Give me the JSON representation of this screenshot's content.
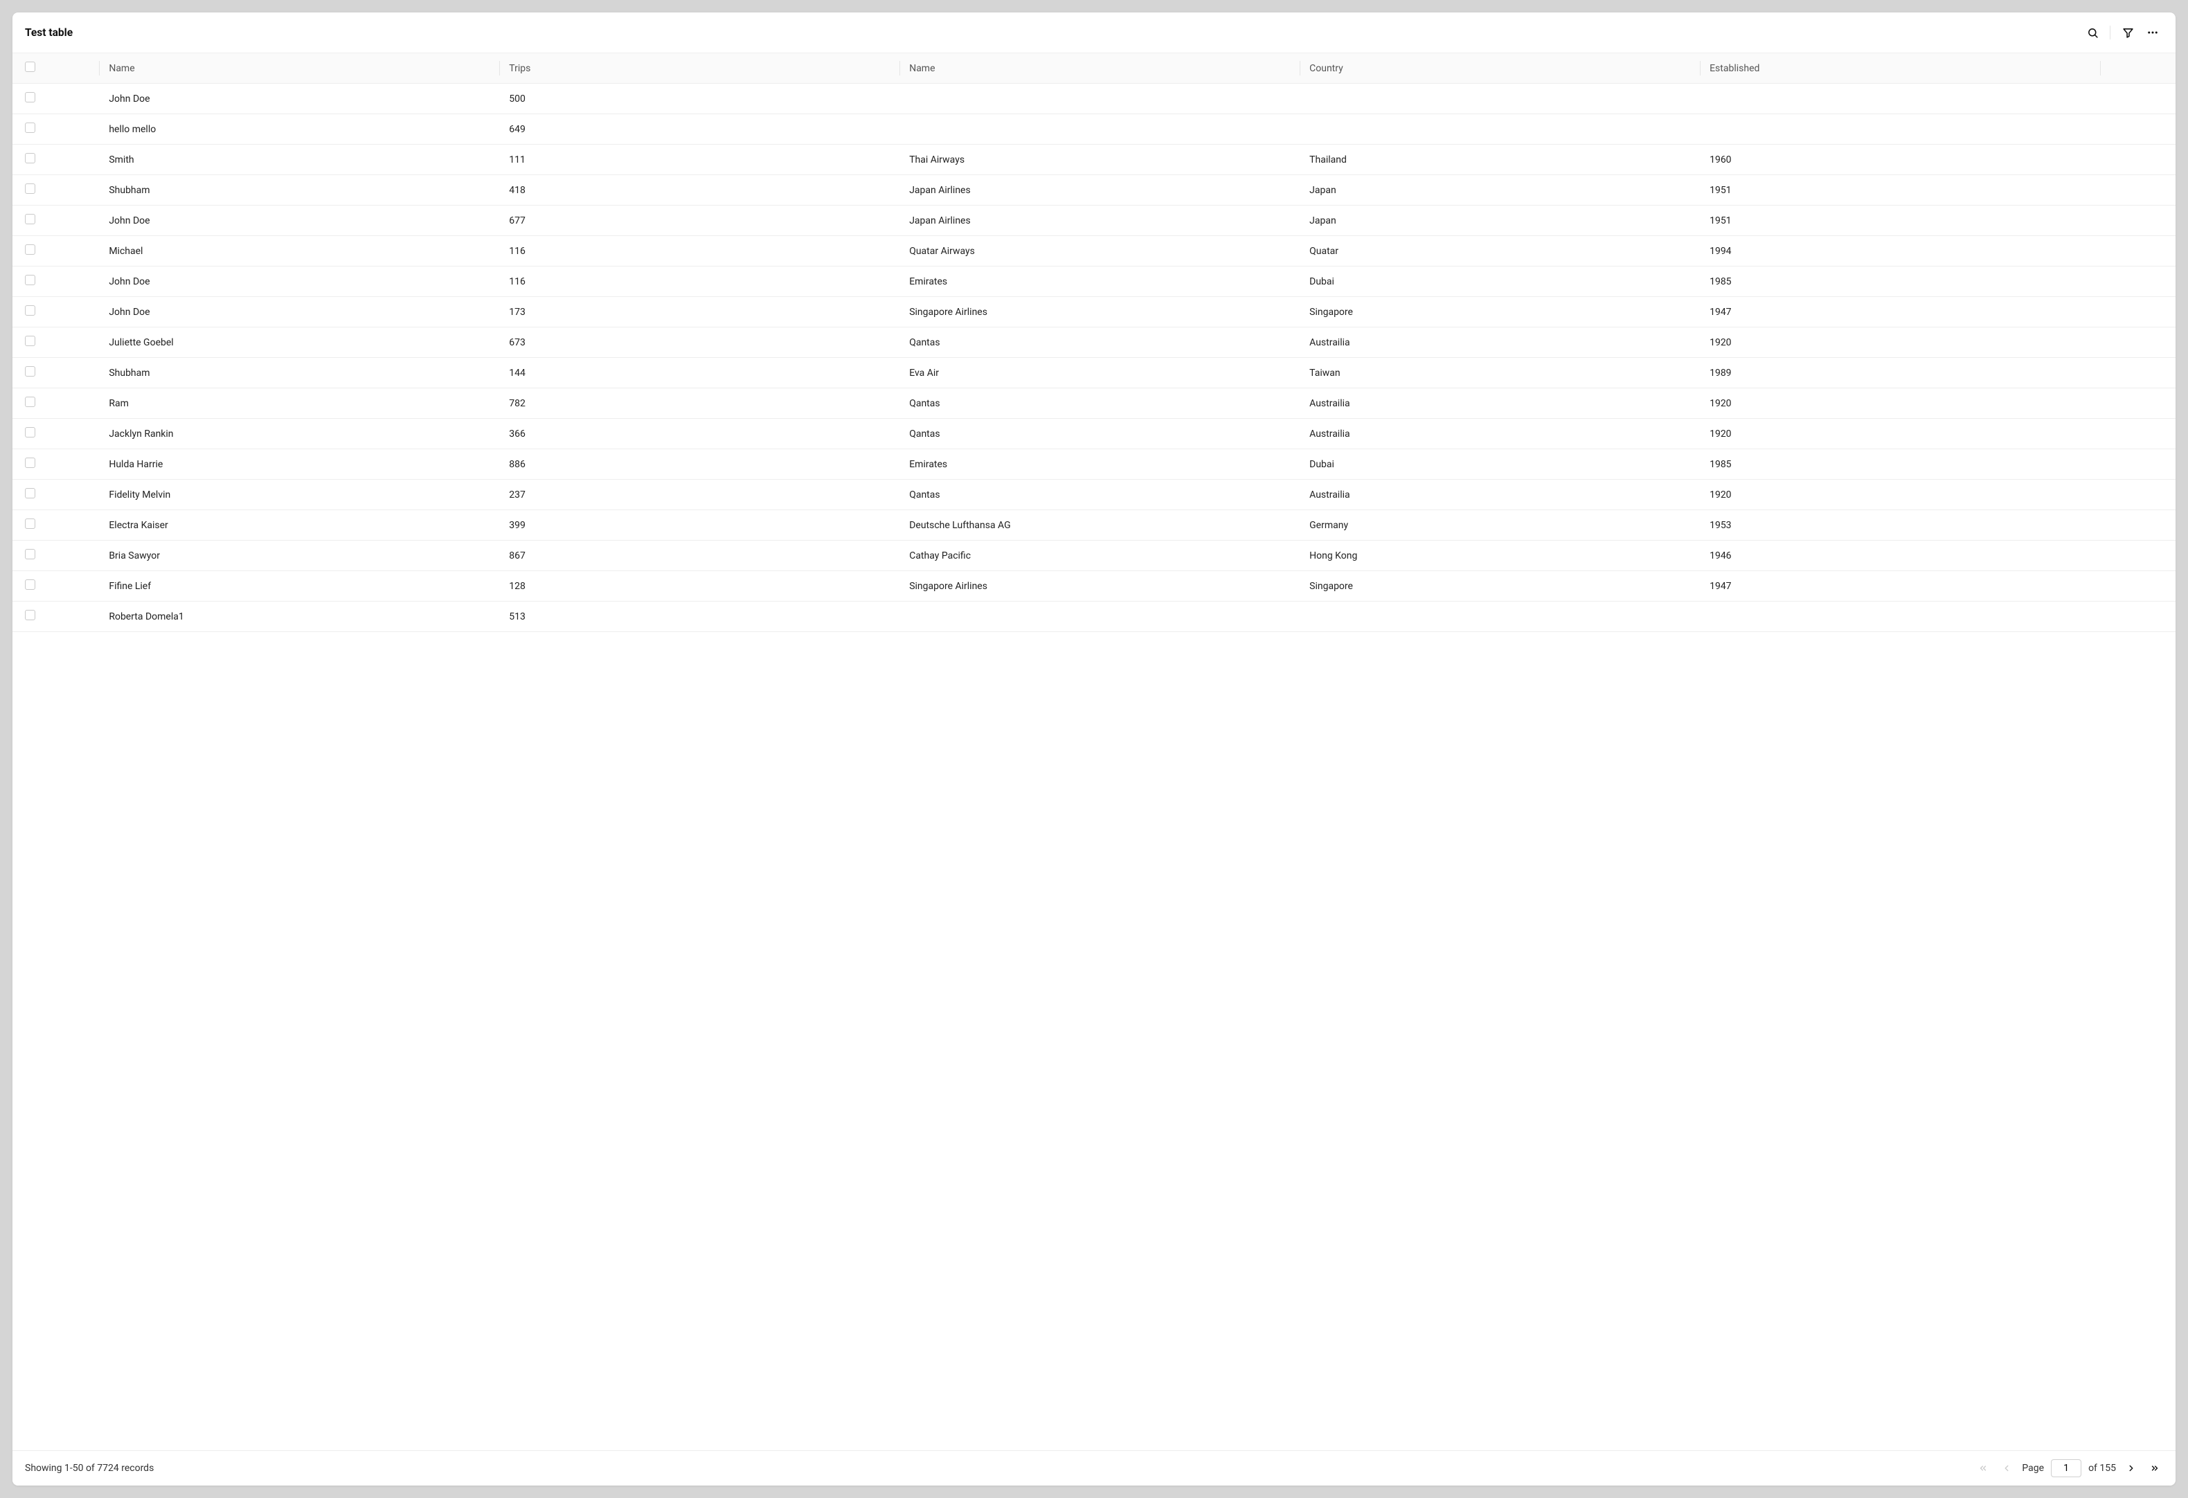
{
  "header": {
    "title": "Test table"
  },
  "columns": {
    "name1": "Name",
    "trips": "Trips",
    "name2": "Name",
    "country": "Country",
    "established": "Established"
  },
  "rows": [
    {
      "name1": "John Doe",
      "trips": "500",
      "name2": "",
      "country": "",
      "established": ""
    },
    {
      "name1": "hello mello",
      "trips": "649",
      "name2": "",
      "country": "",
      "established": ""
    },
    {
      "name1": "Smith",
      "trips": "111",
      "name2": "Thai Airways",
      "country": "Thailand",
      "established": "1960"
    },
    {
      "name1": "Shubham",
      "trips": "418",
      "name2": "Japan Airlines",
      "country": "Japan",
      "established": "1951"
    },
    {
      "name1": "John Doe",
      "trips": "677",
      "name2": "Japan Airlines",
      "country": "Japan",
      "established": "1951"
    },
    {
      "name1": "Michael",
      "trips": "116",
      "name2": "Quatar Airways",
      "country": "Quatar",
      "established": "1994"
    },
    {
      "name1": "John Doe",
      "trips": "116",
      "name2": "Emirates",
      "country": "Dubai",
      "established": "1985"
    },
    {
      "name1": "John Doe",
      "trips": "173",
      "name2": "Singapore Airlines",
      "country": "Singapore",
      "established": "1947"
    },
    {
      "name1": "Juliette Goebel",
      "trips": "673",
      "name2": "Qantas",
      "country": "Austrailia",
      "established": "1920"
    },
    {
      "name1": "Shubham",
      "trips": "144",
      "name2": "Eva Air",
      "country": "Taiwan",
      "established": "1989"
    },
    {
      "name1": "Ram",
      "trips": "782",
      "name2": "Qantas",
      "country": "Austrailia",
      "established": "1920"
    },
    {
      "name1": "Jacklyn Rankin",
      "trips": "366",
      "name2": "Qantas",
      "country": "Austrailia",
      "established": "1920"
    },
    {
      "name1": "Hulda Harrie",
      "trips": "886",
      "name2": "Emirates",
      "country": "Dubai",
      "established": "1985"
    },
    {
      "name1": "Fidelity Melvin",
      "trips": "237",
      "name2": "Qantas",
      "country": "Austrailia",
      "established": "1920"
    },
    {
      "name1": "Electra Kaiser",
      "trips": "399",
      "name2": "Deutsche Lufthansa AG",
      "country": "Germany",
      "established": "1953"
    },
    {
      "name1": "Bria Sawyor",
      "trips": "867",
      "name2": "Cathay Pacific",
      "country": "Hong Kong",
      "established": "1946"
    },
    {
      "name1": "Fifine Lief",
      "trips": "128",
      "name2": "Singapore Airlines",
      "country": "Singapore",
      "established": "1947"
    },
    {
      "name1": "Roberta Domela1",
      "trips": "513",
      "name2": "",
      "country": "",
      "established": ""
    }
  ],
  "footer": {
    "status": "Showing 1-50 of 7724 records",
    "page_label": "Page",
    "page_value": "1",
    "of_label": "of 155"
  }
}
